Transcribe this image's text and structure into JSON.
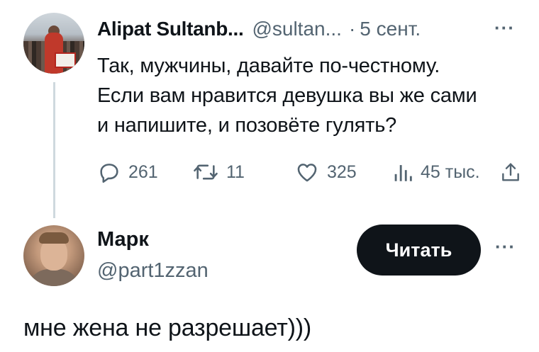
{
  "tweet": {
    "author_name": "Alipat Sultanb...",
    "author_handle": "@sultan...",
    "separator": "·",
    "date": "5 сент.",
    "more": "···",
    "text_lines": [
      "Так, мужчины, давайте по-честному.",
      "Если вам нравится девушка вы же сами",
      "и напишите, и позовёте гулять?"
    ],
    "actions": {
      "replies": "261",
      "retweets": "11",
      "likes": "325",
      "views": "45 тыс."
    },
    "icons": [
      "reply-icon",
      "retweet-icon",
      "like-icon",
      "views-icon",
      "share-icon"
    ]
  },
  "reply": {
    "author_name": "Марк",
    "author_handle": "@part1zzan",
    "follow_label": "Читать",
    "more": "···",
    "text": "мне жена не разрешает)))"
  },
  "colors": {
    "text": "#0f1419",
    "secondary": "#536471",
    "thread_line": "#cfd9de",
    "button_bg": "#0f1419",
    "button_text": "#ffffff"
  }
}
